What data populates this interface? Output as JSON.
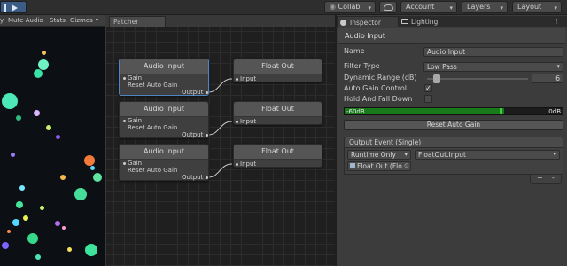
{
  "toolbar": {
    "collab": "Collab",
    "account": "Account",
    "layers": "Layers",
    "layout": "Layout"
  },
  "game_view": {
    "toolbar_items": [
      "y",
      "Mute Audio",
      "Stats",
      "Gizmos"
    ]
  },
  "patcher": {
    "tab_label": "Patcher",
    "nodes": [
      {
        "title": "Audio Input",
        "inputs": [
          "Gain",
          "Reset Auto Gain"
        ],
        "output": "Output"
      },
      {
        "title": "Float Out",
        "input": "Input"
      },
      {
        "title": "Audio Input",
        "inputs": [
          "Gain",
          "Reset Auto Gain"
        ],
        "output": "Output"
      },
      {
        "title": "Float Out",
        "input": "Input"
      },
      {
        "title": "Audio Input",
        "inputs": [
          "Gain",
          "Reset Auto Gain"
        ],
        "output": "Output"
      },
      {
        "title": "Float Out",
        "input": "Input"
      }
    ]
  },
  "inspector": {
    "tabs": [
      "Inspector",
      "Lighting"
    ],
    "header": "Audio Input",
    "name_label": "Name",
    "name_value": "Audio Input",
    "filter_label": "Filter Type",
    "filter_value": "Low Pass",
    "dynamic_label": "Dynamic Range (dB)",
    "dynamic_value": "6",
    "dynamic_fraction": 0.0,
    "agc_label": "Auto Gain Control",
    "agc_checked": true,
    "hold_label": "Hold And Fall Down",
    "hold_checked": false,
    "meter_min": "-60dB",
    "meter_max": "0dB",
    "meter_level": 0.73,
    "meter_peak": 0.71,
    "reset_button": "Reset Auto Gain",
    "event_header": "Output Event (Single)",
    "event_mode": "Runtime Only",
    "event_target": "FloatOut.Input",
    "event_object": "Float Out (Flo",
    "add_label": "+",
    "remove_label": "-"
  },
  "colors": {
    "accent": "#4d86c7",
    "meter_fill": "#197a1c",
    "meter_peak": "#39d13b"
  }
}
